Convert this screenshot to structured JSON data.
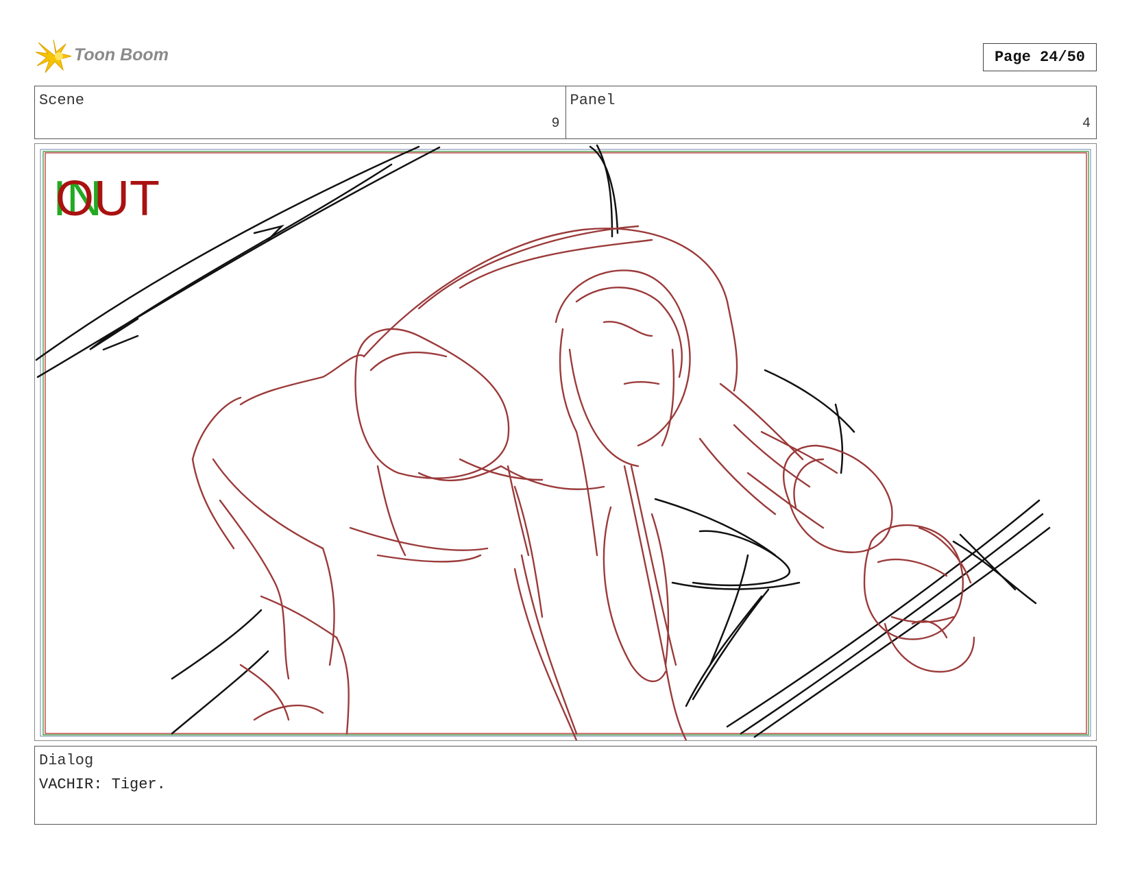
{
  "header": {
    "logo_text": "Toon Boom",
    "page_label": "Page 24/50"
  },
  "scene": {
    "label": "Scene",
    "value": "9"
  },
  "panel": {
    "label": "Panel",
    "value": "4"
  },
  "frame": {
    "in_marker": "IN",
    "out_marker": "OUT",
    "colors": {
      "in": "#22aa22",
      "out": "#aa1111",
      "sketch_red": "#9b3a3a",
      "sketch_black": "#111111"
    }
  },
  "dialog": {
    "label": "Dialog",
    "text": "VACHIR: Tiger."
  }
}
